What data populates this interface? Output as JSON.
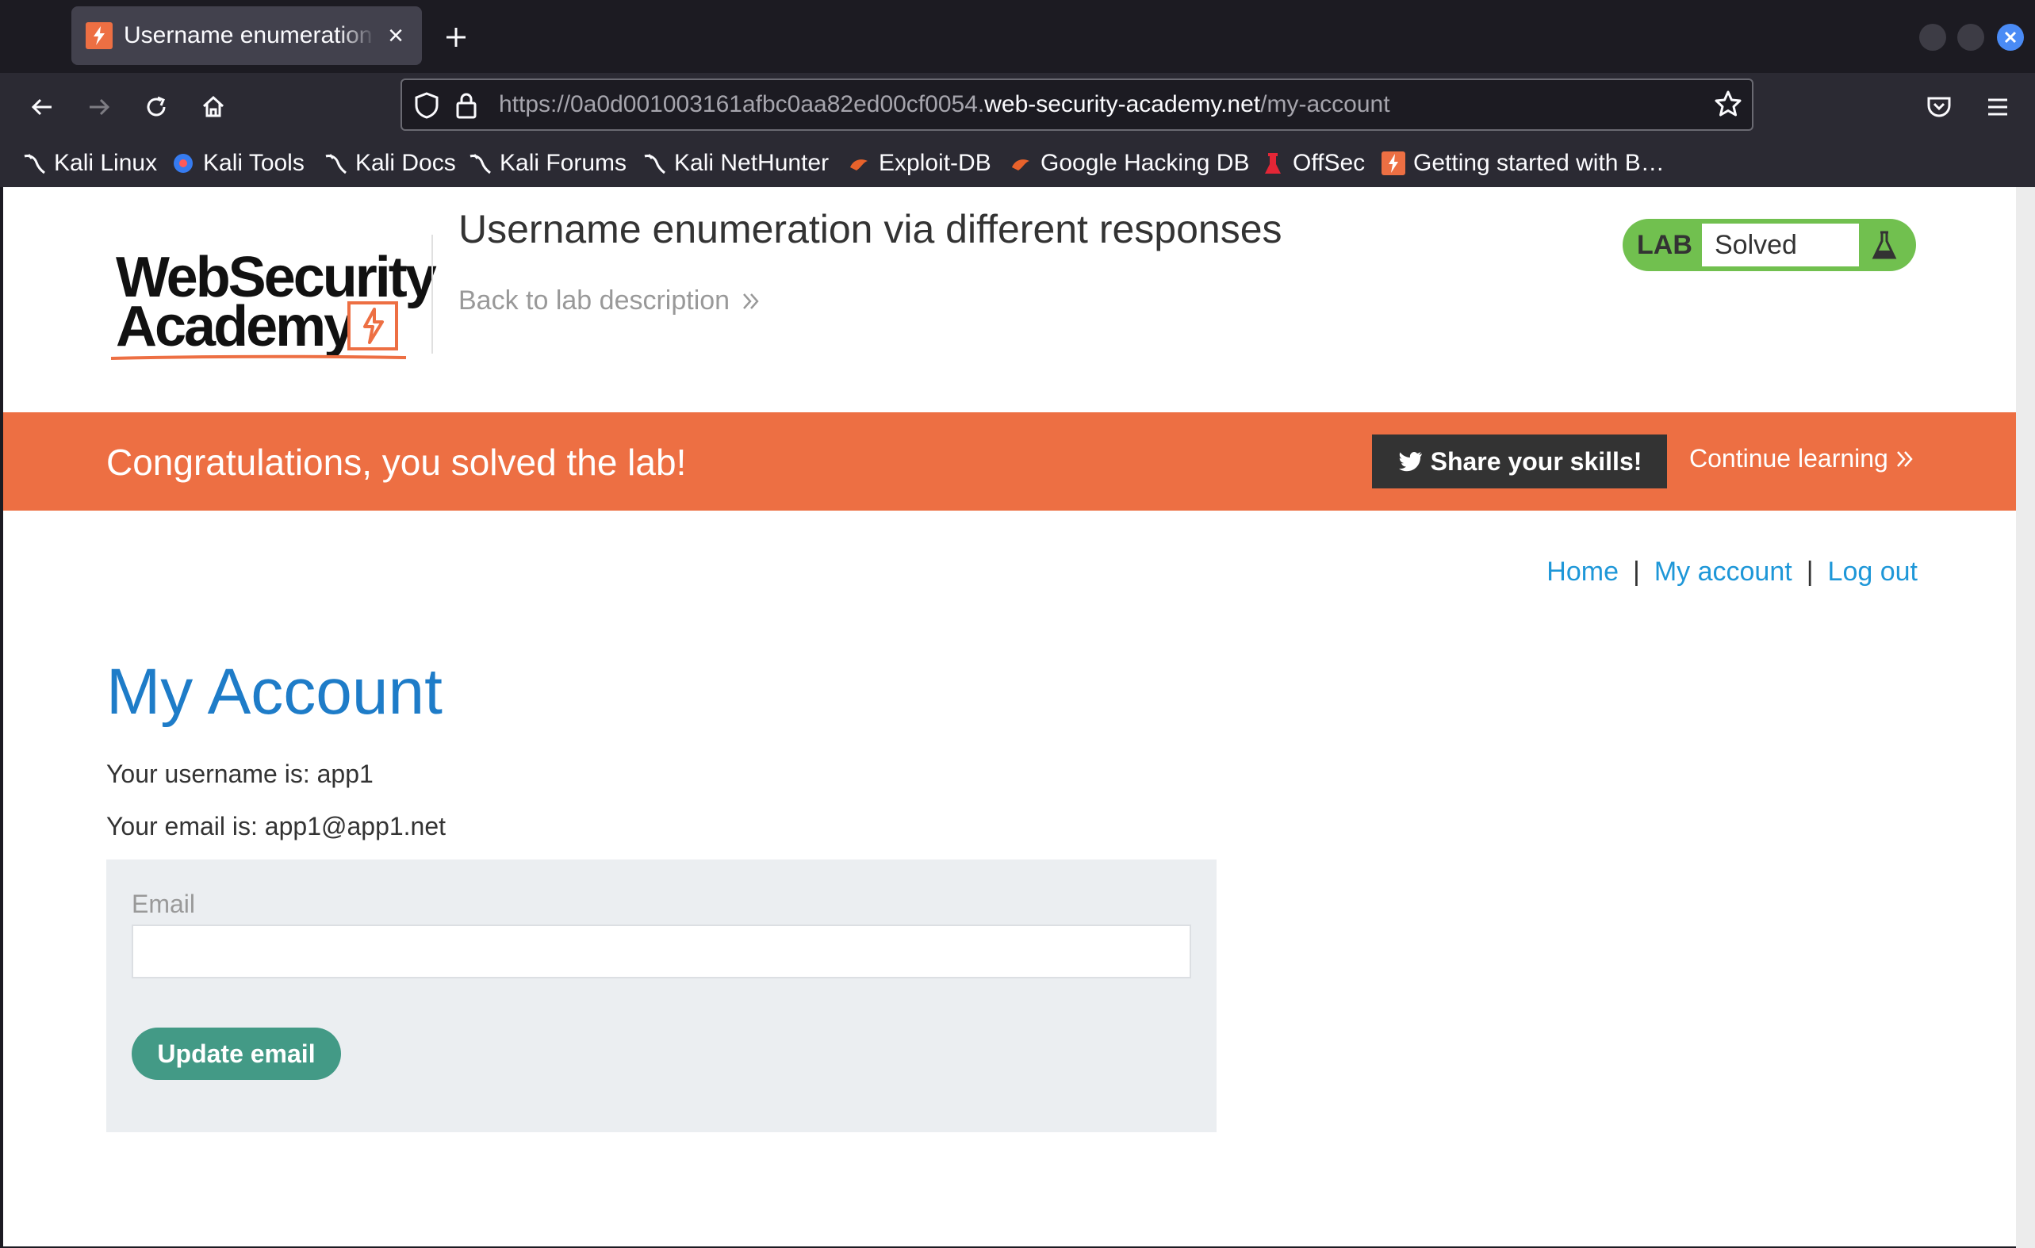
{
  "browser": {
    "tab_title": "Username enumeration via different responses",
    "url": {
      "scheme_prefix": "https://0a0d001003161afbc0aa82ed00cf0054.",
      "host": "web-security-academy.net",
      "path": "/my-account"
    },
    "bookmarks": [
      {
        "label": "Kali Linux",
        "icon": "kali-dragon-icon"
      },
      {
        "label": "Kali Tools",
        "icon": "kali-tools-icon"
      },
      {
        "label": "Kali Docs",
        "icon": "kali-dragon-icon"
      },
      {
        "label": "Kali Forums",
        "icon": "kali-dragon-icon"
      },
      {
        "label": "Kali NetHunter",
        "icon": "kali-dragon-icon"
      },
      {
        "label": "Exploit-DB",
        "icon": "exploit-db-icon"
      },
      {
        "label": "Google Hacking DB",
        "icon": "exploit-db-icon"
      },
      {
        "label": "OffSec",
        "icon": "offsec-icon"
      },
      {
        "label": "Getting started with B…",
        "icon": "burp-icon"
      }
    ]
  },
  "header": {
    "logo_line1": "WebSecurity",
    "logo_line2": "Academy",
    "lab_title": "Username enumeration via different responses",
    "back_link": "Back to lab description",
    "lab_badge": {
      "label": "LAB",
      "status": "Solved"
    }
  },
  "banner": {
    "message": "Congratulations, you solved the lab!",
    "share_button": "Share your skills!",
    "continue_link": "Continue learning"
  },
  "nav": {
    "home": "Home",
    "separator": "|",
    "my_account": "My account",
    "log_out": "Log out"
  },
  "account": {
    "heading": "My Account",
    "username_line": "Your username is: app1",
    "email_line": "Your email is: app1@app1.net",
    "form": {
      "email_label": "Email",
      "email_value": "",
      "submit_label": "Update email"
    }
  },
  "colors": {
    "accent_orange": "#ed6f43",
    "link_blue": "#1e97d8",
    "heading_blue": "#1e7cc8",
    "lab_green": "#71c04f",
    "button_teal": "#439a86"
  }
}
